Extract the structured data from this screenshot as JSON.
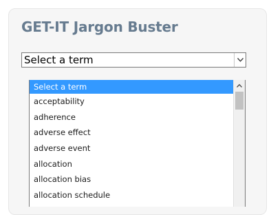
{
  "widget": {
    "title": "GET-IT Jargon Buster"
  },
  "select": {
    "selected_value": "Select a term",
    "arrow_icon": "chevron-down-icon"
  },
  "dropdown": {
    "options": [
      {
        "label": "Select a term",
        "selected": true
      },
      {
        "label": "acceptability",
        "selected": false
      },
      {
        "label": "adherence",
        "selected": false
      },
      {
        "label": "adverse effect",
        "selected": false
      },
      {
        "label": "adverse event",
        "selected": false
      },
      {
        "label": "allocation",
        "selected": false
      },
      {
        "label": "allocation bias",
        "selected": false
      },
      {
        "label": "allocation schedule",
        "selected": false
      }
    ],
    "highlight_color": "#3399ff"
  },
  "colors": {
    "title": "#667b8f",
    "card_background": "#f6f6f6"
  }
}
